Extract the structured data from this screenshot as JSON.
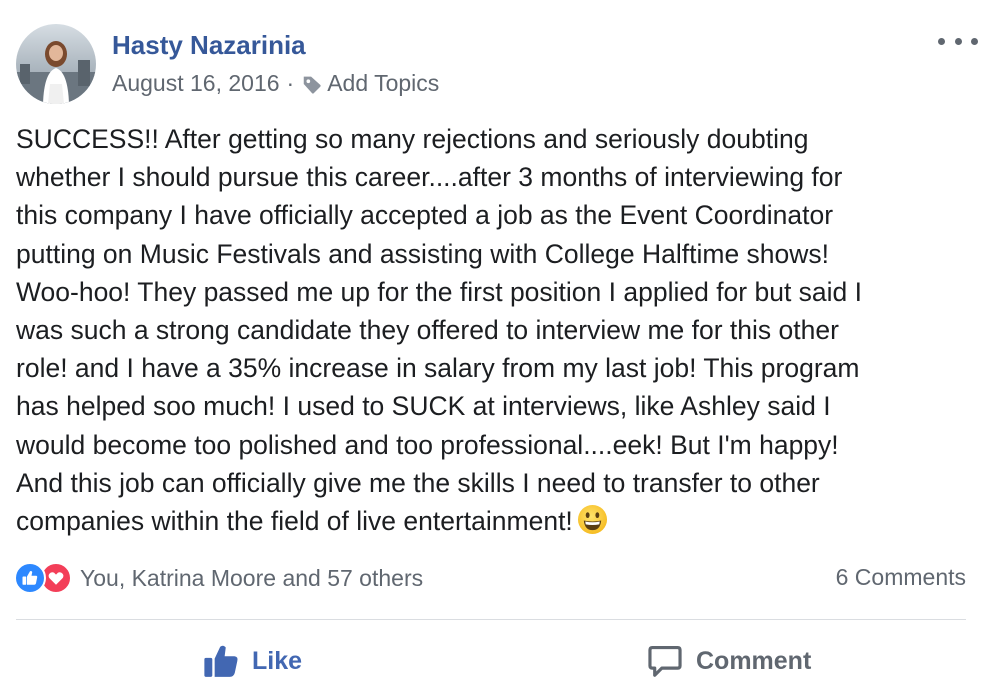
{
  "post": {
    "author": "Hasty Nazarinia",
    "date": "August 16, 2016",
    "separator": "·",
    "add_topics": "Add Topics",
    "body": "SUCCESS!! After getting so many rejections and seriously doubting\nwhether I should pursue this career....after 3 months of interviewing for\nthis company I have officially accepted a job as the Event Coordinator\nputting on Music Festivals and assisting with College Halftime shows!\nWoo-hoo! They passed me up for the first position I applied for but said I\nwas such a strong candidate they offered to interview me for this other\nrole! and I have a 35% increase in salary from my last job! This program\nhas helped soo much! I used to SUCK at interviews, like Ashley said I\nwould become too polished and too professional....eek! But I'm happy!\nAnd this job can officially give me the skills I need to transfer to other\ncompanies within the field of live entertainment!",
    "emoji": "grinning-face-emoji"
  },
  "footer": {
    "reactions_text": "You, Katrina Moore and 57 others",
    "comments_text": "6 Comments",
    "reaction_icons": [
      "like-icon",
      "love-icon"
    ]
  },
  "actions": {
    "like_label": "Like",
    "comment_label": "Comment"
  },
  "colors": {
    "author": "#365899",
    "meta": "#606770",
    "like_active": "#4267b2",
    "reaction_like": "#2d88ff",
    "reaction_love": "#f33e58",
    "divider": "#dadde1"
  }
}
